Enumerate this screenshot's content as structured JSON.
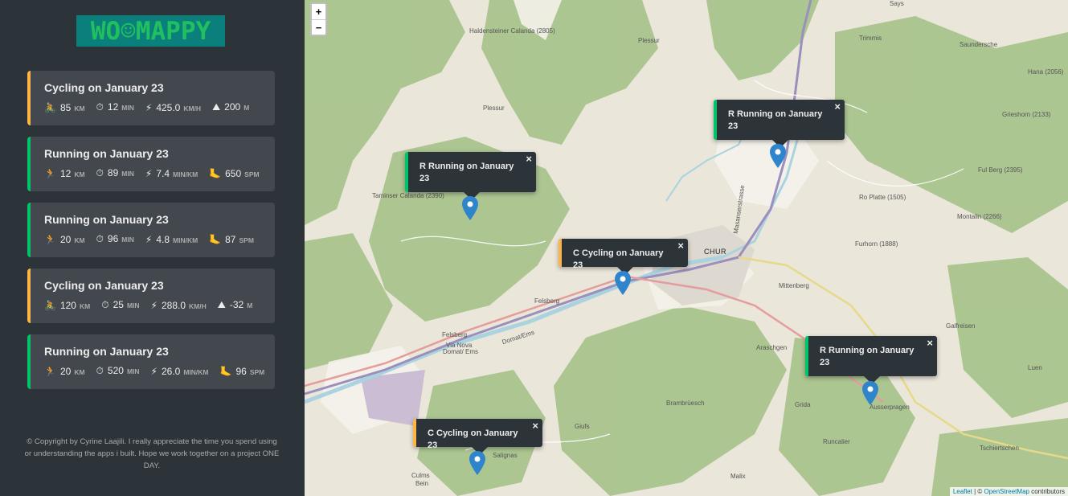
{
  "logo": {
    "text": "WO☺MAPPY"
  },
  "workouts": [
    {
      "type": "cycling",
      "title": "Cycling on January 23",
      "d1_icon": "🚴",
      "d1_val": "85",
      "d1_unit": "KM",
      "d2_val": "12",
      "d2_unit": "MIN",
      "d3_val": "425.0",
      "d3_unit": "KM/H",
      "d4_icon": "⛰",
      "d4_val": "200",
      "d4_unit": "M"
    },
    {
      "type": "running",
      "title": "Running on January 23",
      "d1_icon": "🏃",
      "d1_val": "12",
      "d1_unit": "KM",
      "d2_val": "89",
      "d2_unit": "MIN",
      "d3_val": "7.4",
      "d3_unit": "MIN/KM",
      "d4_icon": "🦶",
      "d4_val": "650",
      "d4_unit": "SPM"
    },
    {
      "type": "running",
      "title": "Running on January 23",
      "d1_icon": "🏃",
      "d1_val": "20",
      "d1_unit": "KM",
      "d2_val": "96",
      "d2_unit": "MIN",
      "d3_val": "4.8",
      "d3_unit": "MIN/KM",
      "d4_icon": "🦶",
      "d4_val": "87",
      "d4_unit": "SPM"
    },
    {
      "type": "cycling",
      "title": "Cycling on January 23",
      "d1_icon": "🚴",
      "d1_val": "120",
      "d1_unit": "KM",
      "d2_val": "25",
      "d2_unit": "MIN",
      "d3_val": "288.0",
      "d3_unit": "KM/H",
      "d4_icon": "⛰",
      "d4_val": "-32",
      "d4_unit": "M"
    },
    {
      "type": "running",
      "title": "Running on January 23",
      "d1_icon": "🏃",
      "d1_val": "20",
      "d1_unit": "KM",
      "d2_val": "520",
      "d2_unit": "MIN",
      "d3_val": "26.0",
      "d3_unit": "MIN/KM",
      "d4_icon": "🦶",
      "d4_val": "96",
      "d4_unit": "SPM"
    }
  ],
  "icons": {
    "timer": "⏱",
    "speed": "⚡"
  },
  "copyright": "© Copyright by Cyrine Laajili. I really appreciate the time you spend using or understanding the apps i built. Hope we work together on a project ONE DAY.",
  "map": {
    "zoom_in": "+",
    "zoom_out": "−",
    "close_icon": "×",
    "popups": {
      "p1": "R Running on January 23",
      "p2": "R Running on January 23",
      "p3": "C Cycling on January 23",
      "p4": "R Running on January 23",
      "p5": "C Cycling on January 23"
    },
    "places": {
      "haldensteiner": "Haldensteiner Calanda (2805)",
      "plessur1": "Plessur",
      "plessur2": "Plessur",
      "says": "Says",
      "trimmis": "Trimmis",
      "saund": "Saundersche",
      "hana": "Hana (2056)",
      "grieshorn": "Grieshorn (2133)",
      "fulberg": "Ful Berg (2395)",
      "rosplatte": "Ro Platte (1505)",
      "montalin": "Montalin (2266)",
      "furhorn": "Furhorn (1888)",
      "chur": "CHUR",
      "masans": "Masanserstrasse",
      "mittenberg": "Mittenberg",
      "felsberg1": "Felsberg",
      "felsberg2": "Felsberg",
      "domat": "Domat/Ems",
      "ems": "Domat/ Ems",
      "vanova": "Via Nova",
      "araschgen": "Araschgen",
      "galfreisen": "Galfreisen",
      "luen": "Luen",
      "grida": "Grida",
      "ausserpragen": "Ausserpragen",
      "brambruesch": "Brambrüesch",
      "runcalier": "Runcalier",
      "tschiertschen": "Tschiertschen",
      "malix": "Malix",
      "giufs": "Giufs",
      "salignas": "Salignas",
      "culms": "Culms",
      "bein": "Bein",
      "taminser": "Taminser Calanda (2390)"
    },
    "attribution_leaflet": "Leaflet",
    "attribution_sep": " | © ",
    "attribution_osm": "OpenStreetMap",
    "attribution_rest": " contributors"
  },
  "colors": {
    "cycling": "#ffb545",
    "running": "#00c46a",
    "sidebar": "#2d3439",
    "card": "#42484d"
  }
}
